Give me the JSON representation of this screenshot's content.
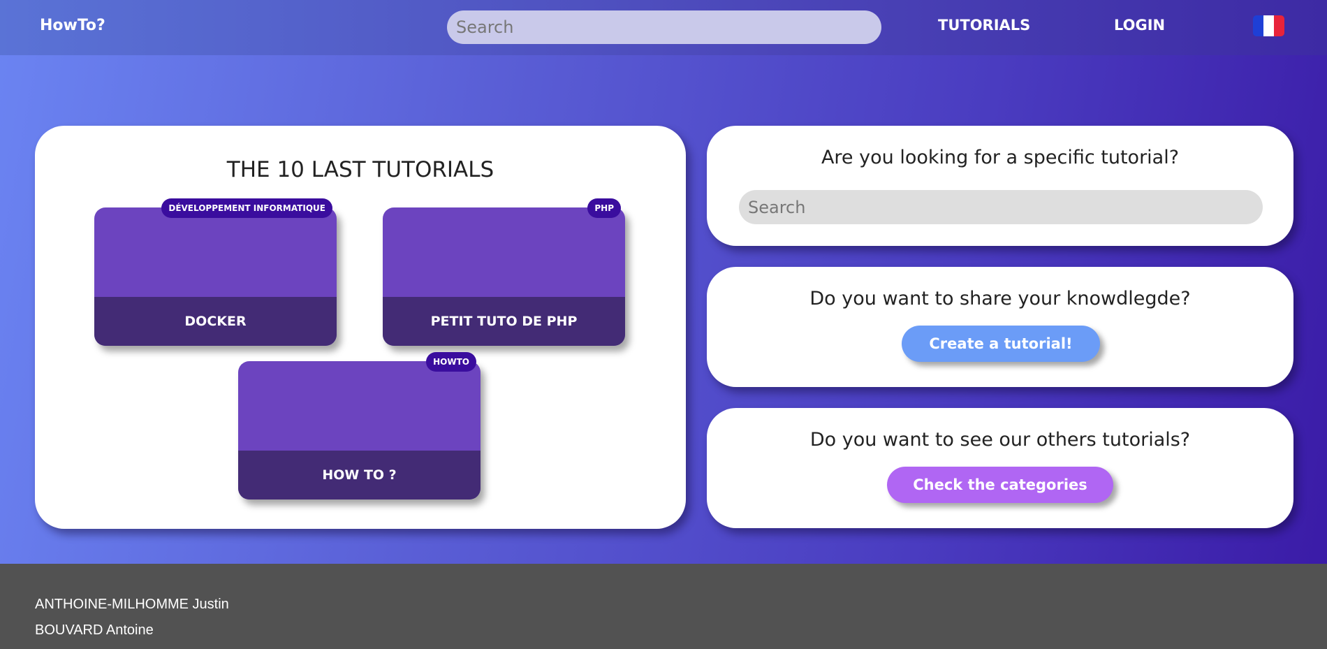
{
  "header": {
    "brand": "HowTo?",
    "search_placeholder": "Search",
    "nav": {
      "tutorials": "TUTORIALS",
      "login": "LOGIN"
    },
    "flag_colors": [
      "#1e3fd6",
      "#ffffff",
      "#e8233a"
    ]
  },
  "latest": {
    "title": "THE 10 LAST TUTORIALS",
    "items": [
      {
        "name": "DOCKER",
        "category": "DÉVELOPPEMENT INFORMATIQUE"
      },
      {
        "name": "PETIT TUTO DE PHP",
        "category": "PHP"
      },
      {
        "name": "HOW TO ?",
        "category": "HOWTO"
      }
    ]
  },
  "search_card": {
    "title": "Are you looking for a specific tutorial?",
    "placeholder": "Search"
  },
  "share_card": {
    "title": "Do you want to share your knowdlegde?",
    "button": "Create a tutorial!"
  },
  "others_card": {
    "title": "Do you want to see our others tutorials?",
    "button": "Check the categories"
  },
  "footer": {
    "authors": [
      "ANTHOINE-MILHOMME Justin",
      "BOUVARD Antoine"
    ]
  },
  "colors": {
    "tutorial_top": "#6c44bf",
    "tutorial_bottom": "#432b75",
    "badge": "#3a0d9e",
    "create_button": "#6b9cf7",
    "categories_button": "#b066f3",
    "footer": "#525252"
  }
}
